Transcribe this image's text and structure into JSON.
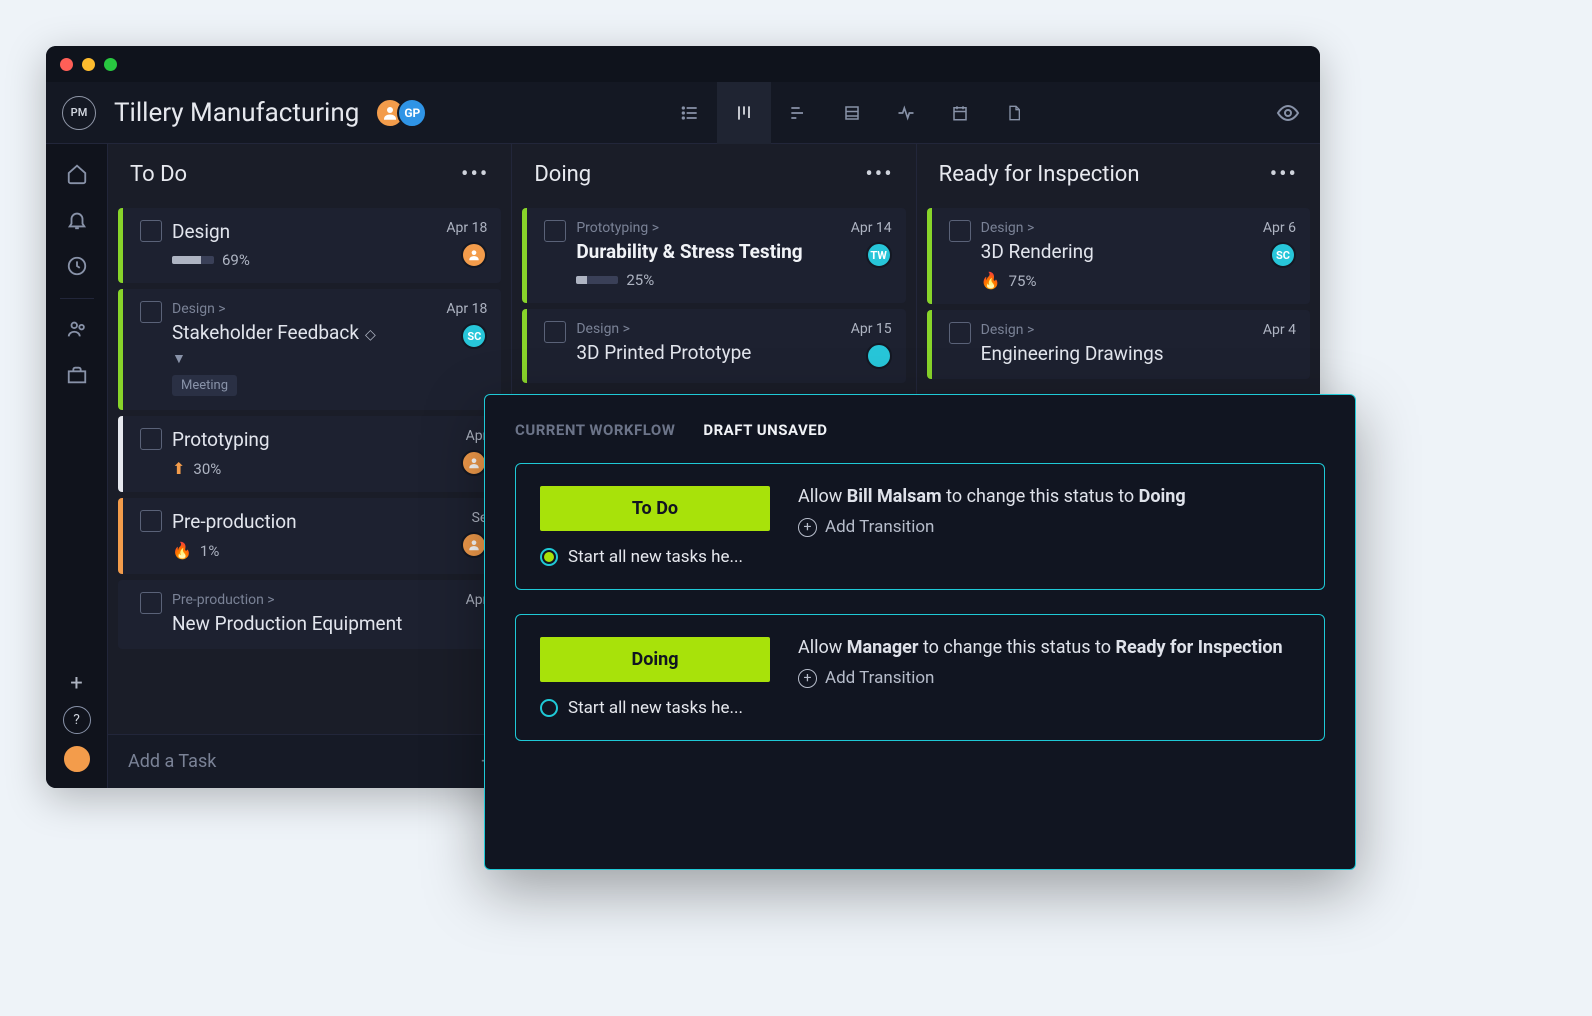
{
  "project_title": "Tillery Manufacturing",
  "avatars": {
    "gp_initials": "GP"
  },
  "columns": [
    {
      "title": "To Do",
      "cards": [
        {
          "stripe": "green",
          "breadcrumb": "",
          "title": "Design",
          "bold": false,
          "progress": 69,
          "pct_label": "69%",
          "icon": "none",
          "due": "Apr 18",
          "assignee": {
            "type": "orange"
          },
          "diamond": false,
          "extra": ""
        },
        {
          "stripe": "green",
          "breadcrumb": "Design >",
          "title": "Stakeholder Feedback",
          "bold": false,
          "progress": null,
          "pct_label": "",
          "icon": "none",
          "due": "Apr 18",
          "assignee": {
            "type": "teal",
            "initials": "SC"
          },
          "diamond": true,
          "tag": "Meeting",
          "chev": true
        },
        {
          "stripe": "white",
          "breadcrumb": "",
          "title": "Prototyping",
          "bold": false,
          "progress": null,
          "pct_label": "30%",
          "icon": "up",
          "due": "Apr",
          "assignee": {
            "type": "orange"
          },
          "diamond": false
        },
        {
          "stripe": "orange",
          "breadcrumb": "",
          "title": "Pre-production",
          "bold": false,
          "progress": null,
          "pct_label": "1%",
          "icon": "flame",
          "due": "Se",
          "assignee": {
            "type": "orange"
          },
          "diamond": false
        },
        {
          "stripe": "",
          "breadcrumb": "Pre-production >",
          "title": "New Production Equipment",
          "bold": false,
          "progress": null,
          "pct_label": "",
          "icon": "none",
          "due": "Apr",
          "assignee": null,
          "diamond": false
        }
      ],
      "add_label": "Add a Task"
    },
    {
      "title": "Doing",
      "cards": [
        {
          "stripe": "green",
          "breadcrumb": "Prototyping >",
          "title": "Durability & Stress Testing",
          "bold": true,
          "progress": 25,
          "pct_label": "25%",
          "icon": "none",
          "due": "Apr 14",
          "assignee": {
            "type": "teal",
            "initials": "TW"
          }
        },
        {
          "stripe": "green",
          "breadcrumb": "Design >",
          "title": "3D Printed Prototype",
          "bold": false,
          "progress": null,
          "pct_label": "",
          "icon": "none",
          "due": "Apr 15",
          "assignee": {
            "type": "teal"
          }
        }
      ]
    },
    {
      "title": "Ready for Inspection",
      "cards": [
        {
          "stripe": "green",
          "breadcrumb": "Design >",
          "title": "3D Rendering",
          "bold": false,
          "progress": null,
          "pct_label": "75%",
          "icon": "flame",
          "due": "Apr 6",
          "assignee": {
            "type": "teal",
            "initials": "SC"
          }
        },
        {
          "stripe": "green",
          "breadcrumb": "Design >",
          "title": "Engineering Drawings",
          "bold": false,
          "progress": null,
          "pct_label": "",
          "icon": "none",
          "due": "Apr 4",
          "assignee": null
        }
      ]
    }
  ],
  "workflow_panel": {
    "tab_inactive": "CURRENT WORKFLOW",
    "tab_active": "DRAFT UNSAVED",
    "statuses": [
      {
        "pill": "To Do",
        "radio_filled": true,
        "radio_label": "Start all new tasks he...",
        "desc": {
          "prefix": "Allow ",
          "actor": "Bill Malsam",
          "middle": " to change this status to ",
          "target": "Doing"
        },
        "add_label": "Add Transition"
      },
      {
        "pill": "Doing",
        "radio_filled": false,
        "radio_label": "Start all new tasks he...",
        "desc": {
          "prefix": "Allow ",
          "actor": "Manager",
          "middle": " to change this status to ",
          "target": "Ready for Inspection"
        },
        "add_label": "Add Transition"
      }
    ]
  }
}
